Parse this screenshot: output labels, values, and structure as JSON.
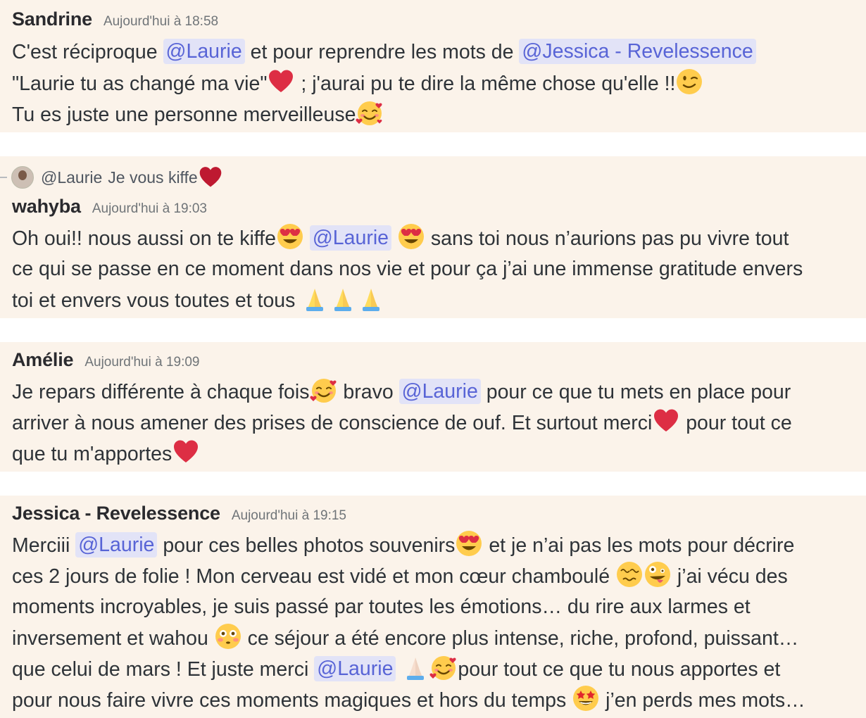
{
  "colors": {
    "message_bg": "#fbf3ea",
    "mention_bg": "#e2e3f7",
    "mention_text": "#5864d6",
    "timestamp": "#6f7478"
  },
  "messages": [
    {
      "author": "Sandrine",
      "timestamp": "Aujourd'hui à 18:58",
      "lines": [
        {
          "t1": "C'est réciproque ",
          "m1": "@Laurie",
          "t2": "  et pour reprendre les mots de ",
          "m2": "@Jessica - Revelessence"
        },
        {
          "t1": "\"Laurie tu as changé  ma vie\"",
          "e1": "red-heart-emoji",
          "t2": " ; j'aurai pu te dire la même chose qu'elle !!",
          "e2": "winking-face-emoji"
        },
        {
          "t1": "Tu es juste une personne merveilleuse",
          "e1": "smiling-face-with-hearts-emoji"
        }
      ]
    },
    {
      "reply": {
        "name": "@Laurie",
        "text": "Je vous kiffe ",
        "icon": "red-heart-emoji"
      },
      "author": "wahyba",
      "timestamp": "Aujourd'hui à 19:03",
      "lines": [
        {
          "t1": "Oh oui!! nous aussi on te kiffe",
          "e1": "heart-eyes-emoji",
          "m1": "@Laurie",
          "e2": "heart-eyes-emoji",
          "t2": " sans toi nous n’aurions pas pu vivre tout"
        },
        {
          "t1": "ce qui se passe en ce moment dans nos vie et pour ça j’ai une immense gratitude envers"
        },
        {
          "t1": "toi et envers vous toutes et tous ",
          "e1": "folded-hands-emoji"
        }
      ]
    },
    {
      "author": "Amélie",
      "timestamp": "Aujourd'hui à 19:09",
      "lines": [
        {
          "t1": "Je repars différente à chaque fois",
          "e1": "smiling-face-with-hearts-emoji",
          "t2": " bravo ",
          "m1": "@Laurie",
          "t3": " pour ce que tu mets en place pour"
        },
        {
          "t1": "arriver à nous amener des prises de conscience de ouf. Et surtout merci",
          "e1": "red-heart-emoji",
          "t2": " pour tout ce"
        },
        {
          "t1": "que tu m'apportes",
          "e1": "red-heart-emoji"
        }
      ]
    },
    {
      "author": "Jessica - Revelessence",
      "timestamp": "Aujourd'hui à 19:15",
      "lines": [
        {
          "t1": "Merciii ",
          "m1": "@Laurie",
          "t2": " pour ces belles photos souvenirs",
          "e1": "heart-eyes-emoji",
          "t3": " et je n’ai pas les mots pour décrire"
        },
        {
          "t1": "ces 2 jours de folie ! Mon cerveau est vidé et mon cœur chamboulé ",
          "e1": "woozy-face-emoji",
          "e2": "zany-face-emoji",
          "t2": " j’ai vécu des"
        },
        {
          "t1": "moments incroyables, je suis passé par toutes les émotions… du rire aux larmes et"
        },
        {
          "t1": "inversement et wahou ",
          "e1": "flushed-face-emoji",
          "t2": " ce séjour a été encore plus intense, riche, profond, puissant…"
        },
        {
          "t1": "que celui de mars ! Et juste merci ",
          "m1": "@Laurie",
          "e1": "folded-hands-light-emoji",
          "e2": "smiling-face-with-hearts-emoji",
          "t2": "pour tout ce que tu nous apportes et"
        },
        {
          "t1": "pour nous faire vivre ces moments magiques et hors du temps ",
          "e1": "star-struck-emoji",
          "t2": " j’en perds mes mots…"
        }
      ]
    }
  ]
}
